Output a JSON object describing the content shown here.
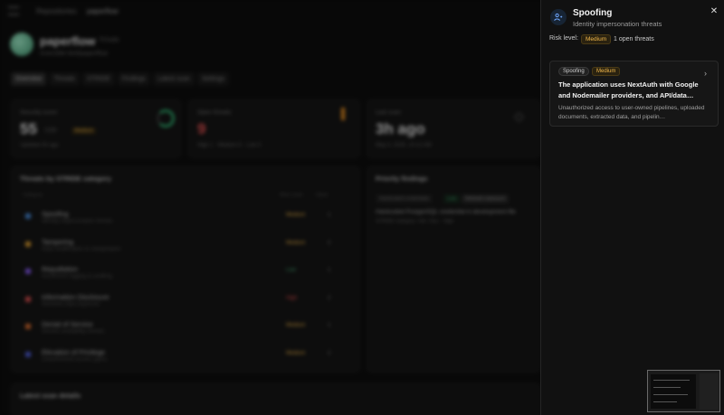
{
  "background": {
    "breadcrumbs": [
      "Repositories",
      "paperflow"
    ],
    "project": {
      "name": "paperflow",
      "badge": "Private",
      "subtitle": "invincible-bird/paperflow"
    },
    "tabs": [
      "Overview",
      "Threats",
      "STRIDE",
      "Findings",
      "Latest scan",
      "Settings"
    ],
    "active_tab": "Overview",
    "cards": [
      {
        "label": "Security score",
        "value": "55",
        "extra": "/100",
        "note": "Updated 3h ago"
      },
      {
        "label": "Open threats",
        "value": "9",
        "note": "High 1 · Medium 5 · Low 3"
      },
      {
        "label": "Last scan",
        "value": "3h ago",
        "note": "May 4, 2025, 10:12 AM"
      }
    ],
    "stride_panel": {
      "title": "Threats by STRIDE category",
      "columns": [
        "Category",
        "Risk Level",
        "Open"
      ],
      "rows": [
        {
          "name": "Spoofing",
          "desc": "Identity impersonation threats",
          "level": "Medium",
          "count": "1",
          "color": "#4a90e2"
        },
        {
          "name": "Tampering",
          "desc": "Data modification & manipulation",
          "level": "Medium",
          "count": "2",
          "color": "#e0a030"
        },
        {
          "name": "Repudiation",
          "desc": "Insufficient logging & auditing",
          "level": "Low",
          "count": "1",
          "color": "#8a5cf6"
        },
        {
          "name": "Information Disclosure",
          "desc": "Sensitive data exposure",
          "level": "High",
          "count": "2",
          "color": "#e05050"
        },
        {
          "name": "Denial of Service",
          "desc": "Service availability threats",
          "level": "Medium",
          "count": "1",
          "color": "#e07030"
        },
        {
          "name": "Elevation of Privilege",
          "desc": "Unauthorized access gains",
          "level": "Medium",
          "count": "2",
          "color": "#5060e0"
        }
      ]
    },
    "priority_panel": {
      "title": "Priority findings",
      "filters": [
        "Hardcoded credentials",
        "Low",
        "Network exposure"
      ],
      "finding_title": "Hardcoded PostgreSQL credential in development file",
      "finding_meta": "STRIDE Category: Info. Disc · High"
    },
    "latest_scan_title": "Latest scan details"
  },
  "panel": {
    "icon": "user-shield-icon",
    "title": "Spoofing",
    "subtitle": "Identity impersonation threats",
    "risk_label": "Risk level:",
    "risk_value": "Medium",
    "open_threats": "1 open threats",
    "close_icon": "close-icon",
    "finding": {
      "category": "Spoofing",
      "severity": "Medium",
      "title": "The application uses NextAuth with Google and Nodemailer providers, and API/data…",
      "description": "Unauthorized access to user-owned pipelines, uploaded documents, extracted data, and pipelin…",
      "chevron_icon": "chevron-right-icon"
    }
  },
  "colors": {
    "medium": "#f2b84b",
    "low": "#4caf7a",
    "high": "#e05050",
    "panel_bg": "#111111"
  }
}
